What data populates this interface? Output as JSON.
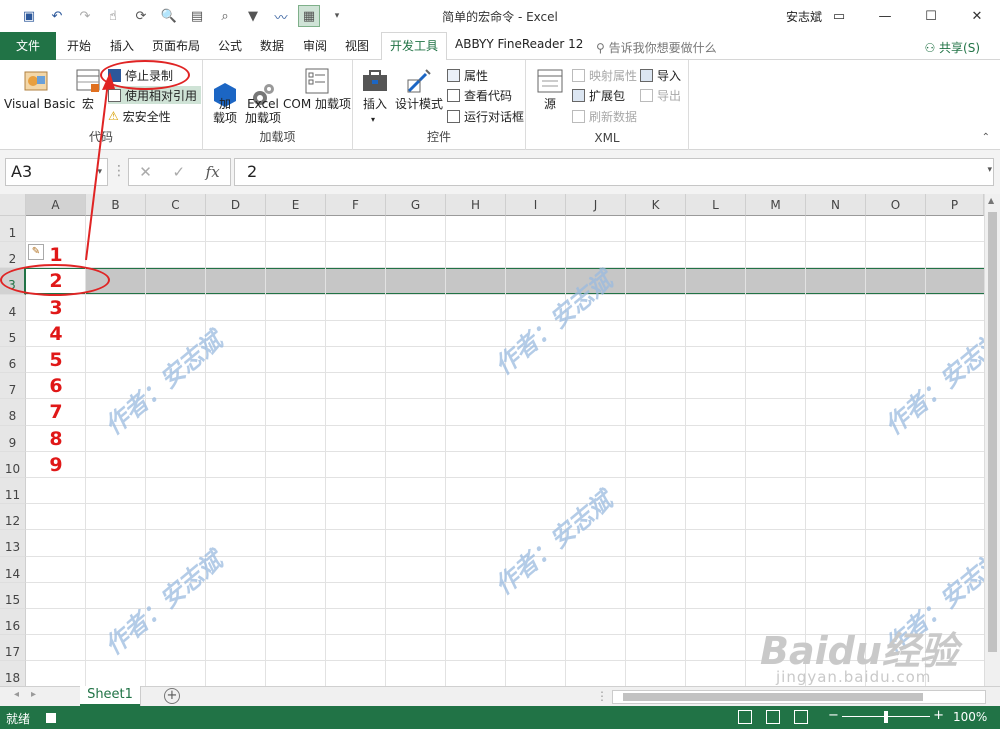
{
  "window": {
    "title": "简单的宏命令 - Excel",
    "user": "安志斌",
    "controls": [
      "▭",
      "—",
      "☐",
      "✕"
    ]
  },
  "tabs": {
    "file": "文件",
    "items": [
      "开始",
      "插入",
      "页面布局",
      "公式",
      "数据",
      "审阅",
      "视图",
      "开发工具",
      "ABBYY FineReader 12"
    ],
    "active": "开发工具",
    "tell_me": "告诉我你想要做什么",
    "share": "共享(S)"
  },
  "ribbon": {
    "code_group": {
      "label": "代码",
      "visual_basic": "Visual Basic",
      "macros": "宏",
      "stop_recording": "停止录制",
      "relative_ref": "使用相对引用",
      "macro_security": "宏安全性"
    },
    "addins_group": {
      "label": "加载项",
      "addins": "加\n载项",
      "excel_addins": "Excel\n加载项",
      "com_addins": "COM 加载项"
    },
    "controls_group": {
      "label": "控件",
      "insert": "插入",
      "design_mode": "设计模式",
      "properties": "属性",
      "view_code": "查看代码",
      "run_dialog": "运行对话框"
    },
    "xml_group": {
      "label": "XML",
      "source": "源",
      "map_properties": "映射属性",
      "expansion_packs": "扩展包",
      "refresh_data": "刷新数据",
      "import": "导入",
      "export": "导出"
    }
  },
  "formula_bar": {
    "name_box": "A3",
    "value": "2",
    "fx": "fx"
  },
  "grid": {
    "columns": [
      "A",
      "B",
      "C",
      "D",
      "E",
      "F",
      "G",
      "H",
      "I",
      "J",
      "K",
      "L",
      "M",
      "N",
      "O",
      "P"
    ],
    "rows": [
      "1",
      "2",
      "3",
      "4",
      "5",
      "6",
      "7",
      "8",
      "9",
      "10",
      "11",
      "12",
      "13",
      "14",
      "15",
      "16",
      "17",
      "18"
    ],
    "selected_row": "3",
    "column_a_values": [
      "1",
      "2",
      "3",
      "4",
      "5",
      "6",
      "7",
      "8",
      "9"
    ]
  },
  "watermark": "作者：安志斌",
  "sheet_tabs": {
    "sheet": "Sheet1",
    "add": "+"
  },
  "status_bar": {
    "ready": "就绪",
    "zoom": "100%"
  },
  "branding": {
    "baidu": "Baidu经验",
    "baidu_sub": "jingyan.baidu.com"
  },
  "colors": {
    "excel_green": "#217346",
    "annotation_red": "#e02424",
    "cell_value_red": "#e01818"
  }
}
